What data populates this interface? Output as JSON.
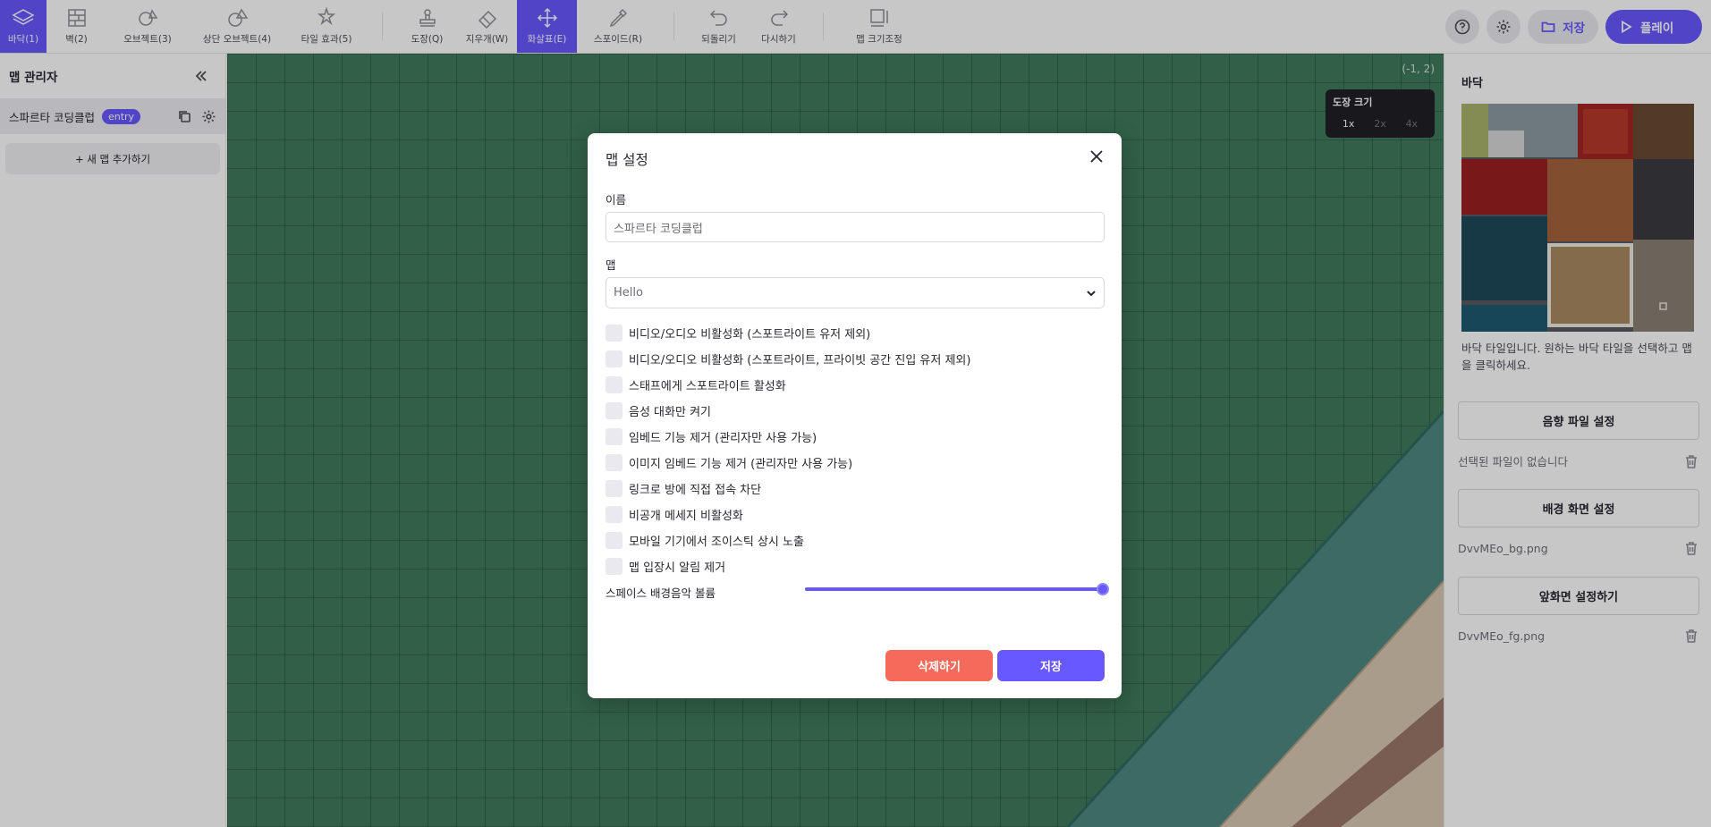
{
  "toolbar": {
    "tools": [
      {
        "label": "바닥(1)",
        "icon": "layers-icon"
      },
      {
        "label": "벽(2)",
        "icon": "wall-icon"
      },
      {
        "label": "오브젝트(3)",
        "icon": "object-icon"
      },
      {
        "label": "상단 오브젝트(4)",
        "icon": "top-object-icon"
      },
      {
        "label": "타일 효과(5)",
        "icon": "tile-effect-icon"
      },
      {
        "label": "도장(Q)",
        "icon": "stamp-icon"
      },
      {
        "label": "지우개(W)",
        "icon": "eraser-icon"
      },
      {
        "label": "화살표(E)",
        "icon": "move-arrow-icon"
      },
      {
        "label": "스포이드(R)",
        "icon": "eyedropper-icon"
      },
      {
        "label": "되돌리기",
        "icon": "undo-icon"
      },
      {
        "label": "다시하기",
        "icon": "redo-icon"
      },
      {
        "label": "맵 크기조정",
        "icon": "resize-map-icon"
      }
    ],
    "save_label": "저장",
    "play_label": "플레이"
  },
  "left_sidebar": {
    "title": "맵 관리자",
    "map_name": "스파르타 코딩클럽",
    "entry_badge": "entry",
    "add_map_label": "+ 새 맵 추가하기"
  },
  "canvas": {
    "coordinate": "(-1, 2)",
    "brush_title": "도장 크기",
    "brush_sizes": [
      "1x",
      "2x",
      "4x"
    ],
    "selected_brush": "1x"
  },
  "right_sidebar": {
    "title": "바닥",
    "description": "바닥 타일입니다. 원하는 바닥 타일을 선택하고 맵을 클릭하세요.",
    "sound_button": "음향 파일 설정",
    "sound_file": "선택된 파일이 없습니다",
    "background_button": "배경 화면 설정",
    "background_file": "DvvMEo_bg.png",
    "foreground_button": "앞화면 설정하기",
    "foreground_file": "DvvMEo_fg.png"
  },
  "modal": {
    "title": "맵 설정",
    "name_label": "이름",
    "name_value": "스파르타 코딩클럽",
    "map_label": "맵",
    "map_value": "Hello",
    "options": [
      "비디오/오디오 비활성화 (스포트라이트 유저 제외)",
      "비디오/오디오 비활성화 (스포트라이트, 프라이빗 공간 진입 유저 제외)",
      "스태프에게 스포트라이트 활성화",
      "음성 대화만 켜기",
      "임베드 기능 제거 (관리자만 사용 가능)",
      "이미지 임베드 기능 제거 (관리자만 사용 가능)",
      "링크로 방에 직접 접속 차단",
      "비공개 메세지 비활성화",
      "모바일 기기에서 조이스틱 상시 노출",
      "맵 입장시 알림 제거"
    ],
    "options_checked": [
      false,
      false,
      false,
      false,
      false,
      false,
      false,
      false,
      false,
      false
    ],
    "volume_label": "스페이스 배경음악 볼륨",
    "volume_level": 1.0,
    "delete_label": "삭제하기",
    "save_label": "저장"
  },
  "colors": {
    "accent": "#6758ff",
    "danger": "#f56a5a",
    "canvas_green": "#3f7a5c"
  }
}
